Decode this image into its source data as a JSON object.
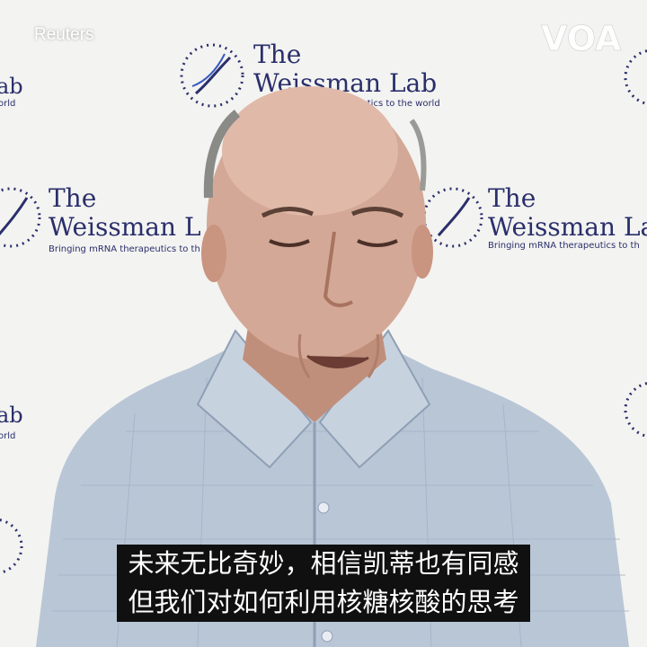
{
  "watermark": {
    "source": "Reuters"
  },
  "logo": {
    "broadcaster": "VOA"
  },
  "backdrop": {
    "title_line1": "The",
    "title_line2": "Weissman Lab",
    "tagline": "Bringing mRNA therapeutics to the world",
    "tagline_partial_top": "Bringing mRNA therapeutics to the world",
    "line2_partial_left": "Weissman L",
    "line2_partial_right": "Weissman La",
    "tagline_partial_left": "Bringing mRNA therapeutics to th",
    "tagline_partial_right": "Bringing mRNA therapeutics to th",
    "edge_fragment_top": "ab",
    "edge_fragment_small": "orld"
  },
  "subtitles": {
    "line1": "未来无比奇妙，相信凯蒂也有同感",
    "line2": "但我们对如何利用核糖核酸的思考"
  },
  "colors": {
    "wall": "#f3f3f1",
    "logo_navy": "#2a2f6b",
    "shirt": "#b9c6d6",
    "skin": "#c89a86",
    "subtitle_box": "#101010",
    "subtitle_text": "#ffffff"
  }
}
